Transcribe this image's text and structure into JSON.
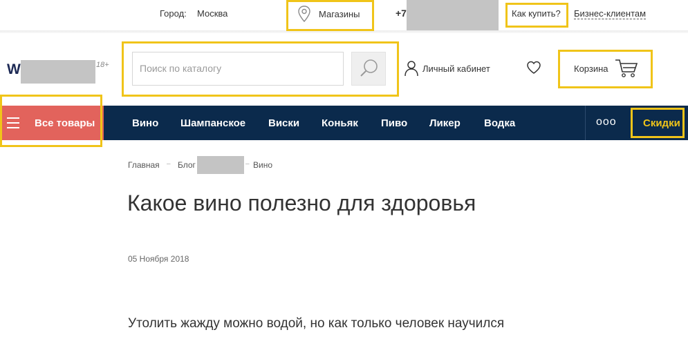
{
  "top_bar": {
    "city_label": "Город:",
    "city_value": "Москва",
    "stores_label": "Магазины",
    "phone_prefix": "+7",
    "how_to_buy": "Как купить?",
    "b2b": "Бизнес-клиентам"
  },
  "header": {
    "logo_letter": "W",
    "age_badge": "18+",
    "search_placeholder": "Поиск по каталогу",
    "account_label": "Личный кабинет",
    "cart_label": "Корзина",
    "icons": [
      "location-pin-icon",
      "search-icon",
      "user-icon",
      "heart-icon",
      "cart-icon"
    ]
  },
  "nav": {
    "all_goods": "Все товары",
    "items": [
      "Вино",
      "Шампанское",
      "Виски",
      "Коньяк",
      "Пиво",
      "Ликер",
      "Водка"
    ],
    "more": "ооо",
    "sale": "Скидки"
  },
  "content": {
    "breadcrumbs": [
      "Главная",
      "Блог",
      "Вино"
    ],
    "title": "Какое вино полезно для здоровья",
    "date": "05 Ноября 2018",
    "lead": "Утолить жажду можно водой, но как только человек научился"
  },
  "colors": {
    "nav_bg": "#0b2a4c",
    "all_goods_bg": "#e2635c",
    "highlight": "#f0c419",
    "sale_text": "#f0c419"
  }
}
